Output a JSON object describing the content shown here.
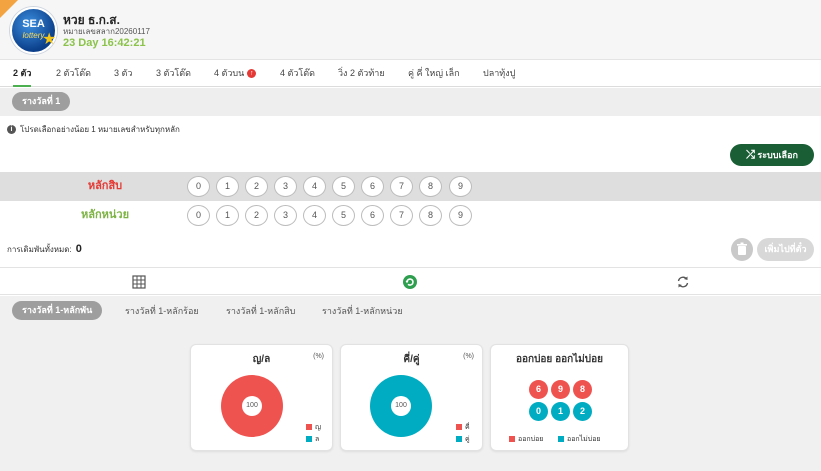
{
  "header": {
    "logo_text": "SEA",
    "logo_sub": "lottery",
    "title": "หวย ธ.ก.ส.",
    "draw_id": "หมายเลขสลาก20260117",
    "time": "23 Day 16:42:21"
  },
  "tabs": [
    {
      "label": "2 ตัว",
      "active": true
    },
    {
      "label": "2 ตัวโต๊ด"
    },
    {
      "label": "3 ตัว"
    },
    {
      "label": "3 ตัวโต๊ด"
    },
    {
      "label": "4 ตัวบน",
      "badge": "↑"
    },
    {
      "label": "4 ตัวโต๊ด"
    },
    {
      "label": "วิ่ง 2 ตัวท้าย"
    },
    {
      "label": "คู่ คี่ ใหญ่ เล็ก"
    },
    {
      "label": "ปลาทุ้งปู"
    }
  ],
  "prize_pill": "รางวัลที่ 1",
  "hint": "โปรดเลือกอย่างน้อย 1 หมายเลขสำหรับทุกหลัก",
  "random_button": "ระบบเลือก",
  "rows": [
    {
      "label": "หลักสิบ",
      "color": "#e53935"
    },
    {
      "label": "หลักหน่วย",
      "color": "#7cb342"
    }
  ],
  "digits": [
    "0",
    "1",
    "2",
    "3",
    "4",
    "5",
    "6",
    "7",
    "8",
    "9"
  ],
  "total": {
    "label": "การเดิมพันทั้งหมด:",
    "value": "0"
  },
  "add_button": "เพิ่มไปที่ตั๋ว",
  "subtabs": [
    {
      "label": "รางวัลที่ 1-หลักพัน",
      "active": true
    },
    {
      "label": "รางวัลที่ 1-หลักร้อย"
    },
    {
      "label": "รางวัลที่ 1-หลักสิบ"
    },
    {
      "label": "รางวัลที่ 1-หลักหน่วย"
    }
  ],
  "cards": {
    "bigsmall": {
      "title": "ญ/ล",
      "pct": "(%)",
      "center": "100",
      "legend": [
        {
          "label": "ญ",
          "color": "#ef5350"
        },
        {
          "label": "ล",
          "color": "#00acc1"
        }
      ]
    },
    "oddeven": {
      "title": "คี่/คู่",
      "pct": "(%)",
      "center": "100",
      "legend": [
        {
          "label": "คี่",
          "color": "#ef5350"
        },
        {
          "label": "คู่",
          "color": "#00acc1"
        }
      ]
    },
    "hotcold": {
      "title": "ออกบ่อย ออกไม่บ่อย",
      "hot": [
        "6",
        "9",
        "8"
      ],
      "cold": [
        "0",
        "1",
        "2"
      ],
      "legend": [
        {
          "label": "ออกบ่อย",
          "color": "#ef5350"
        },
        {
          "label": "ออกไม่บ่อย",
          "color": "#00acc1"
        }
      ]
    }
  },
  "colors": {
    "accent_green": "#1a5e35",
    "hot": "#ef5350",
    "cold": "#00acc1",
    "time_green": "#8bc34a"
  }
}
